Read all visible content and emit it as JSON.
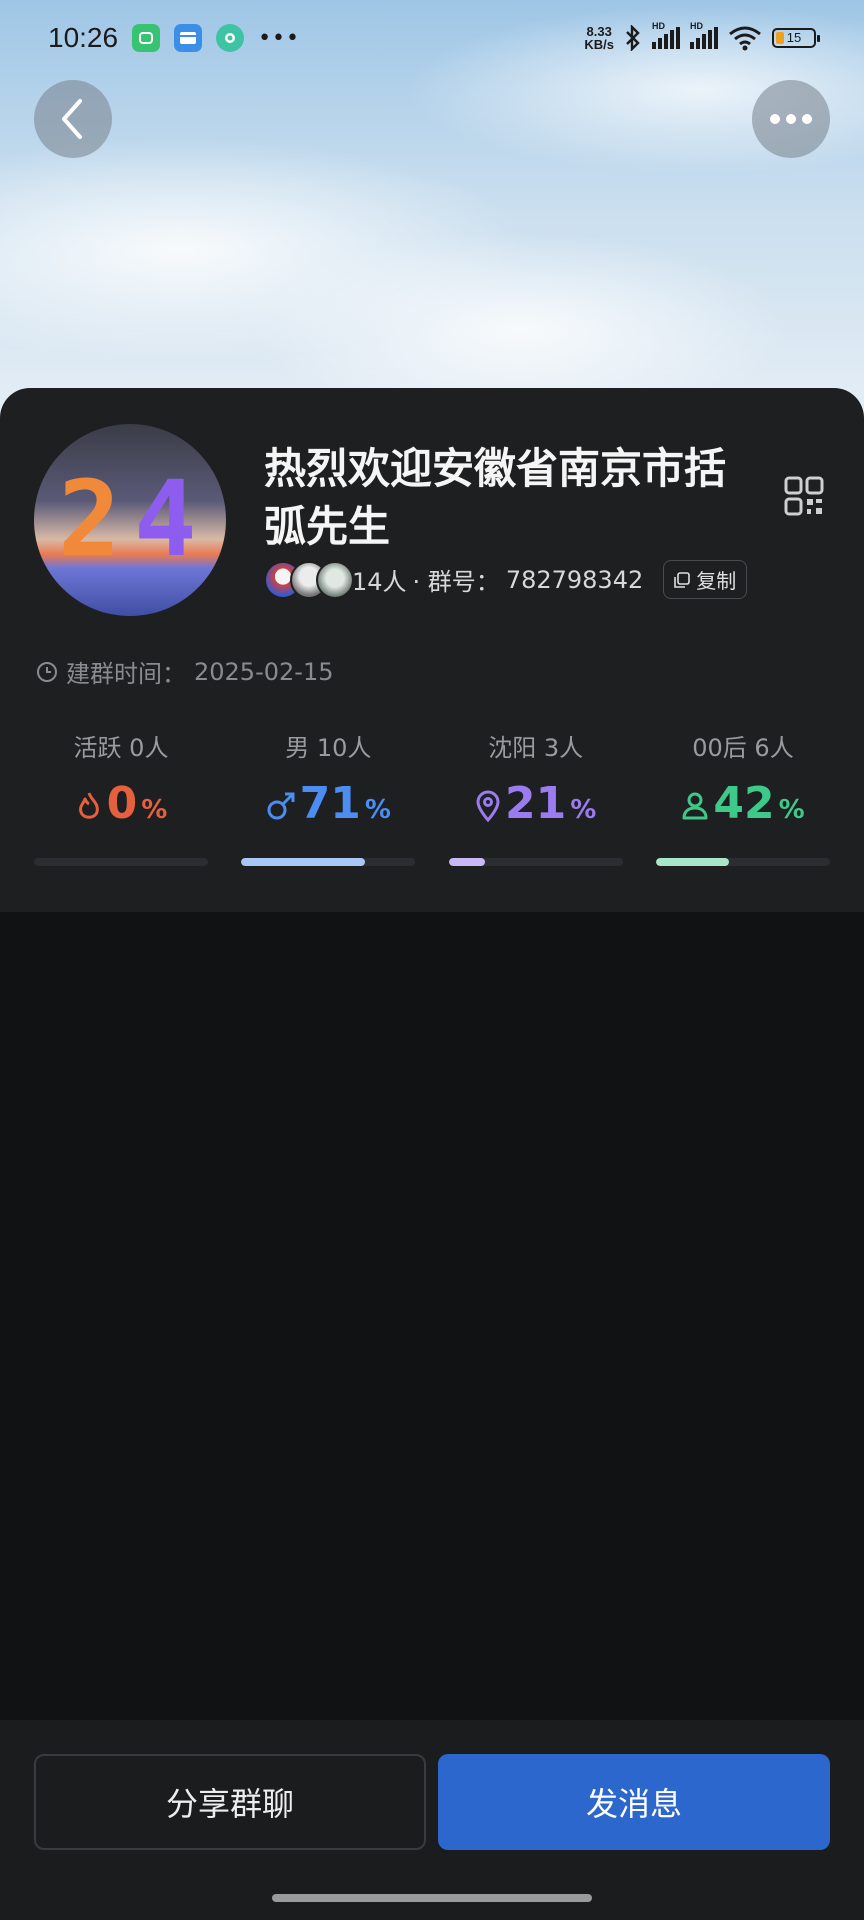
{
  "status_bar": {
    "time": "10:26",
    "net_speed_top": "8.33",
    "net_speed_bottom": "KB/s",
    "battery": "15"
  },
  "group": {
    "title": "热烈欢迎安徽省南京市括弧先生",
    "members": "14人",
    "separator": " · 群号：",
    "group_id": "782798342",
    "copy_label": "复制",
    "created_label": "建群时间：",
    "created_date": "2025-02-15"
  },
  "stats": [
    {
      "label": "活跃 0人",
      "value": "0",
      "unit": "%",
      "icon": "fire-icon",
      "color": "#e5603f",
      "fraction": 0.0
    },
    {
      "label": "男 10人",
      "value": "71",
      "unit": "%",
      "icon": "male-icon",
      "color": "#4b8df0",
      "fraction": 0.71
    },
    {
      "label": "沈阳 3人",
      "value": "21",
      "unit": "%",
      "icon": "location-pin-icon",
      "color": "#9b7cf0",
      "fraction": 0.21
    },
    {
      "label": "00后 6人",
      "value": "42",
      "unit": "%",
      "icon": "person-icon",
      "color": "#3ec98a",
      "fraction": 0.42
    }
  ],
  "bar_colors": [
    "#3a3b40",
    "#a9c7f5",
    "#c9b8f5",
    "#a8e6c8"
  ],
  "buttons": {
    "share": "分享群聊",
    "send": "发消息"
  }
}
